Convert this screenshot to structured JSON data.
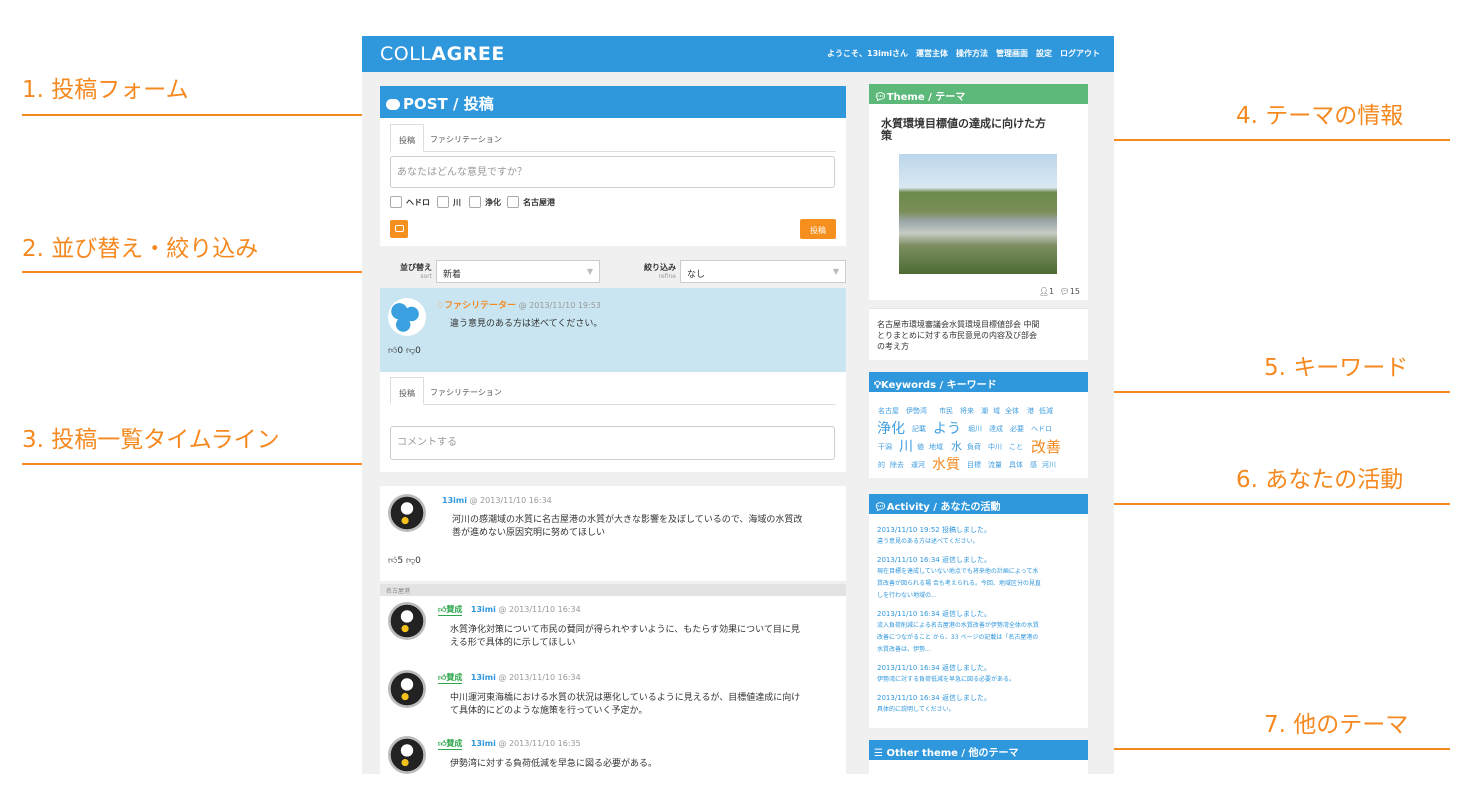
{
  "annotations": {
    "a1": "1. 投稿フォーム",
    "a2": "2. 並び替え・絞り込み",
    "a3": "3. 投稿一覧タイムライン",
    "a4": "4. テーマの情報",
    "a5": "5. キーワード",
    "a6": "6. あなたの活動",
    "a7": "7. 他のテーマ"
  },
  "app": {
    "logo_light": "COLL",
    "logo_bold": "AGREE",
    "nav": [
      "ようこそ、13imiさん",
      "運営主体",
      "操作方法",
      "管理画面",
      "設定",
      "ログアウト"
    ]
  },
  "post": {
    "header": "POST / 投稿",
    "tabs": [
      "投稿",
      "ファシリテーション"
    ],
    "placeholder": "あなたはどんな意見ですか？",
    "tags": [
      "ヘドロ",
      "川",
      "浄化",
      "名古屋港"
    ],
    "camera_icon": "camera-icon",
    "submit_label": "投稿"
  },
  "sort": {
    "sort_label": "並び替え",
    "sort_sub": "sort",
    "sort_value": "新着",
    "refine_label": "絞り込み",
    "refine_sub": "refine",
    "refine_value": "なし"
  },
  "timeline": {
    "facilitator": {
      "name": "ファシリテーター",
      "time": "@ 2013/11/10 19:53",
      "text": "違う意見のある方は述べてください。",
      "likes": "0",
      "dislikes": "0"
    },
    "reply_tabs": [
      "投稿",
      "ファシリテーション"
    ],
    "comment_placeholder": "コメントする",
    "post1": {
      "user": "13imi",
      "time": "@ 2013/11/10 16:34",
      "text_line1": "河川の感潮域の水質に名古屋港の水質が大きな影響を及ぼしているので、海域の水質改",
      "text_line2": "善が進めない原因究明に努めてほしい",
      "likes": "5",
      "dislikes": "0"
    },
    "tag_label": "名古屋港",
    "replies": [
      {
        "agree": "賛成",
        "user": "13imi",
        "time": "@ 2013/11/10 16:34",
        "line1": "水質浄化対策について市民の賛同が得られやすいように、もたらす効果について目に見",
        "line2": "える形で具体的に示してほしい"
      },
      {
        "agree": "賛成",
        "user": "13imi",
        "time": "@ 2013/11/10 16:34",
        "line1": "中川運河東海橋における水質の状況は悪化しているように見えるが、目標値達成に向け",
        "line2": "て具体的にどのような施策を行っていく予定か。"
      },
      {
        "agree": "賛成",
        "user": "13imi",
        "time": "@ 2013/11/10 16:35",
        "line1": "伊勢湾に対する負荷低減を早急に図る必要がある。",
        "line2": ""
      }
    ]
  },
  "theme": {
    "header": "Theme / テーマ",
    "title_line1": "水質環境目標値の達成に向けた方",
    "title_line2": "策",
    "users": "1",
    "comments": "15",
    "desc_line1": "名古屋市環境審議会水質環境目標値部会 中間",
    "desc_line2": "とりまとめに対する市民意見の内容及び部会",
    "desc_line3": "の考え方",
    "header_color": "#5cb97a"
  },
  "keywords": {
    "header": "Keywords / キーワード",
    "row1": [
      "名古屋",
      "伊勢湾",
      "市民",
      "将来",
      "潮",
      "域",
      "全体",
      "港",
      "低減"
    ],
    "row2": [
      "浄化",
      "記載",
      "よう",
      "堀川",
      "達成",
      "必要",
      "ヘドロ"
    ],
    "row3": [
      "干潟",
      "川",
      "値",
      "地域",
      "水",
      "負荷",
      "中川",
      "こと",
      "改善"
    ],
    "row4": [
      "的",
      "除去",
      "運河",
      "水質",
      "目標",
      "流量",
      "具体",
      "感",
      "河川"
    ]
  },
  "activity": {
    "header": "Activity / あなたの活動",
    "items": [
      {
        "head": "2013/11/10 19:52 投稿しました。",
        "lines": [
          "違う意見のある方は述べてください。"
        ]
      },
      {
        "head": "2013/11/10 16:34 返信しました。",
        "lines": [
          "現在目標を達成していない地点でも将来他の計画によって水",
          "質改善が図られる場 合も考えられる。今回、地域区分の見直",
          "しを行わない地域の..."
        ]
      },
      {
        "head": "2013/11/10 16:34 返信しました。",
        "lines": [
          "流入負荷削減による名古屋港の水質改善が伊勢湾全体の水質",
          "改善につながること から、33 ページの記載は「名古屋港の",
          "水質改善は、伊勢..."
        ]
      },
      {
        "head": "2013/11/10 16:34 返信しました。",
        "lines": [
          "伊勢湾に対する負荷低減を早急に図る必要がある。"
        ]
      },
      {
        "head": "2013/11/10 16:34 返信しました。",
        "lines": [
          "具体的に説明してください。"
        ]
      }
    ]
  },
  "other": {
    "header": "Other theme / 他のテーマ"
  },
  "colors": {
    "primary": "#2f97dc",
    "accent": "#f5891f",
    "facilitation_bg": "#c9e5f1",
    "agree": "#2fa84f"
  }
}
